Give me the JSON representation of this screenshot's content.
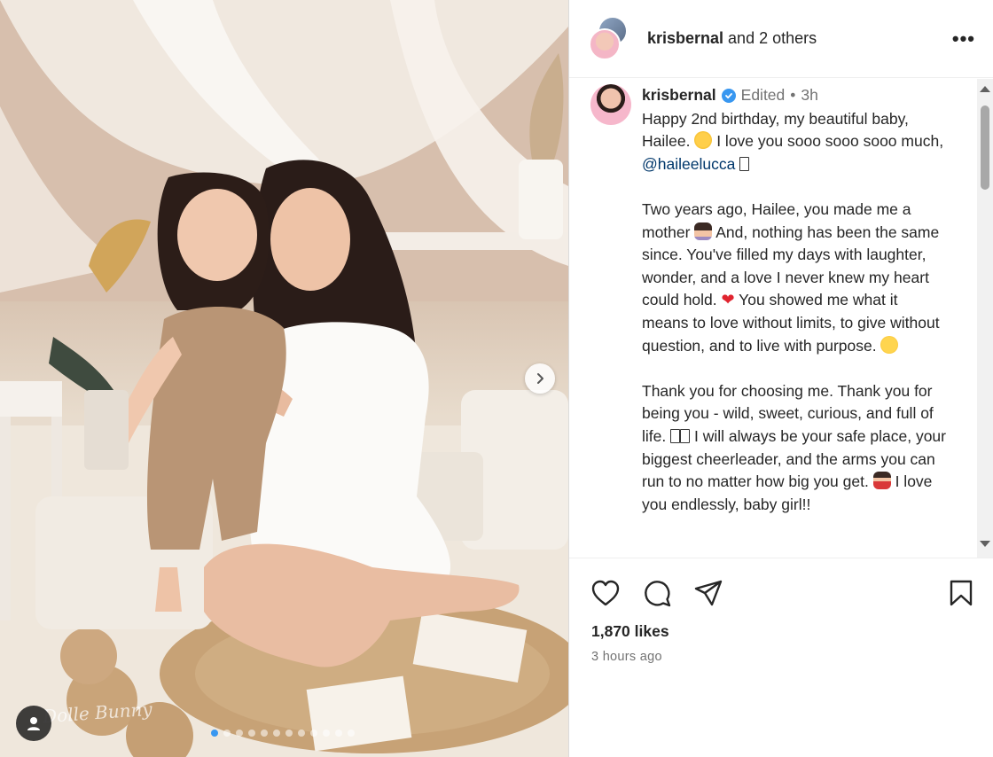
{
  "header": {
    "username": "krisbernal",
    "others": " and 2 others",
    "more_glyph": "•••"
  },
  "caption": {
    "username": "krisbernal",
    "edited": "Edited",
    "separator": "•",
    "age": "3h",
    "p1a": "Happy 2nd birthday, my beautiful baby, Hailee. ",
    "p1b": " I love you sooo sooo sooo much, ",
    "mention": "@haileelucca",
    "p2a": "Two years ago, Hailee, you made me a mother ",
    "p2b": " And, nothing has been the same since. You've filled my days with laughter, wonder, and a love I never knew my heart could hold. ",
    "heart": "❤",
    "p2c": " You showed me what it means to love without limits, to give without question, and to live with purpose. ",
    "p3a": "Thank you for choosing me. Thank you for being you - wild, sweet, curious, and full of life. ",
    "p3b": " I will always be your safe place, your biggest cheerleader, and the arms you can run to no matter how big you get. ",
    "p3c": " I love you endlessly, baby girl!!"
  },
  "stats": {
    "likes": "1,870 likes",
    "time": "3 hours ago"
  },
  "photo": {
    "watermark": "Dolle Bunny",
    "slides": 12,
    "active_slide": 0
  },
  "colors": {
    "accent": "#3897f0",
    "mention": "#00376b",
    "muted": "#737373"
  },
  "icons": [
    "like-icon",
    "comment-icon",
    "share-icon",
    "save-icon",
    "more-icon",
    "next-arrow-icon",
    "tagged-user-icon",
    "verified-icon"
  ]
}
